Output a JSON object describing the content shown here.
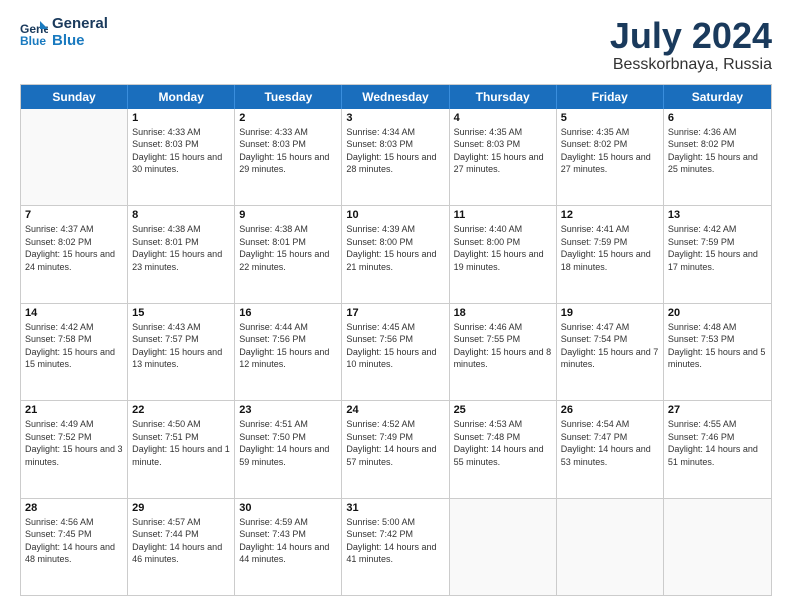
{
  "logo": {
    "line1": "General",
    "line2": "Blue"
  },
  "title": "July 2024",
  "subtitle": "Besskorbnaya, Russia",
  "days": [
    "Sunday",
    "Monday",
    "Tuesday",
    "Wednesday",
    "Thursday",
    "Friday",
    "Saturday"
  ],
  "weeks": [
    [
      {
        "day": "",
        "empty": true
      },
      {
        "day": "1",
        "sunrise": "4:33 AM",
        "sunset": "8:03 PM",
        "daylight": "15 hours and 30 minutes."
      },
      {
        "day": "2",
        "sunrise": "4:33 AM",
        "sunset": "8:03 PM",
        "daylight": "15 hours and 29 minutes."
      },
      {
        "day": "3",
        "sunrise": "4:34 AM",
        "sunset": "8:03 PM",
        "daylight": "15 hours and 28 minutes."
      },
      {
        "day": "4",
        "sunrise": "4:35 AM",
        "sunset": "8:03 PM",
        "daylight": "15 hours and 27 minutes."
      },
      {
        "day": "5",
        "sunrise": "4:35 AM",
        "sunset": "8:02 PM",
        "daylight": "15 hours and 27 minutes."
      },
      {
        "day": "6",
        "sunrise": "4:36 AM",
        "sunset": "8:02 PM",
        "daylight": "15 hours and 25 minutes."
      }
    ],
    [
      {
        "day": "7",
        "sunrise": "4:37 AM",
        "sunset": "8:02 PM",
        "daylight": "15 hours and 24 minutes."
      },
      {
        "day": "8",
        "sunrise": "4:38 AM",
        "sunset": "8:01 PM",
        "daylight": "15 hours and 23 minutes."
      },
      {
        "day": "9",
        "sunrise": "4:38 AM",
        "sunset": "8:01 PM",
        "daylight": "15 hours and 22 minutes."
      },
      {
        "day": "10",
        "sunrise": "4:39 AM",
        "sunset": "8:00 PM",
        "daylight": "15 hours and 21 minutes."
      },
      {
        "day": "11",
        "sunrise": "4:40 AM",
        "sunset": "8:00 PM",
        "daylight": "15 hours and 19 minutes."
      },
      {
        "day": "12",
        "sunrise": "4:41 AM",
        "sunset": "7:59 PM",
        "daylight": "15 hours and 18 minutes."
      },
      {
        "day": "13",
        "sunrise": "4:42 AM",
        "sunset": "7:59 PM",
        "daylight": "15 hours and 17 minutes."
      }
    ],
    [
      {
        "day": "14",
        "sunrise": "4:42 AM",
        "sunset": "7:58 PM",
        "daylight": "15 hours and 15 minutes."
      },
      {
        "day": "15",
        "sunrise": "4:43 AM",
        "sunset": "7:57 PM",
        "daylight": "15 hours and 13 minutes."
      },
      {
        "day": "16",
        "sunrise": "4:44 AM",
        "sunset": "7:56 PM",
        "daylight": "15 hours and 12 minutes."
      },
      {
        "day": "17",
        "sunrise": "4:45 AM",
        "sunset": "7:56 PM",
        "daylight": "15 hours and 10 minutes."
      },
      {
        "day": "18",
        "sunrise": "4:46 AM",
        "sunset": "7:55 PM",
        "daylight": "15 hours and 8 minutes."
      },
      {
        "day": "19",
        "sunrise": "4:47 AM",
        "sunset": "7:54 PM",
        "daylight": "15 hours and 7 minutes."
      },
      {
        "day": "20",
        "sunrise": "4:48 AM",
        "sunset": "7:53 PM",
        "daylight": "15 hours and 5 minutes."
      }
    ],
    [
      {
        "day": "21",
        "sunrise": "4:49 AM",
        "sunset": "7:52 PM",
        "daylight": "15 hours and 3 minutes."
      },
      {
        "day": "22",
        "sunrise": "4:50 AM",
        "sunset": "7:51 PM",
        "daylight": "15 hours and 1 minute."
      },
      {
        "day": "23",
        "sunrise": "4:51 AM",
        "sunset": "7:50 PM",
        "daylight": "14 hours and 59 minutes."
      },
      {
        "day": "24",
        "sunrise": "4:52 AM",
        "sunset": "7:49 PM",
        "daylight": "14 hours and 57 minutes."
      },
      {
        "day": "25",
        "sunrise": "4:53 AM",
        "sunset": "7:48 PM",
        "daylight": "14 hours and 55 minutes."
      },
      {
        "day": "26",
        "sunrise": "4:54 AM",
        "sunset": "7:47 PM",
        "daylight": "14 hours and 53 minutes."
      },
      {
        "day": "27",
        "sunrise": "4:55 AM",
        "sunset": "7:46 PM",
        "daylight": "14 hours and 51 minutes."
      }
    ],
    [
      {
        "day": "28",
        "sunrise": "4:56 AM",
        "sunset": "7:45 PM",
        "daylight": "14 hours and 48 minutes."
      },
      {
        "day": "29",
        "sunrise": "4:57 AM",
        "sunset": "7:44 PM",
        "daylight": "14 hours and 46 minutes."
      },
      {
        "day": "30",
        "sunrise": "4:59 AM",
        "sunset": "7:43 PM",
        "daylight": "14 hours and 44 minutes."
      },
      {
        "day": "31",
        "sunrise": "5:00 AM",
        "sunset": "7:42 PM",
        "daylight": "14 hours and 41 minutes."
      },
      {
        "day": "",
        "empty": true
      },
      {
        "day": "",
        "empty": true
      },
      {
        "day": "",
        "empty": true
      }
    ]
  ]
}
